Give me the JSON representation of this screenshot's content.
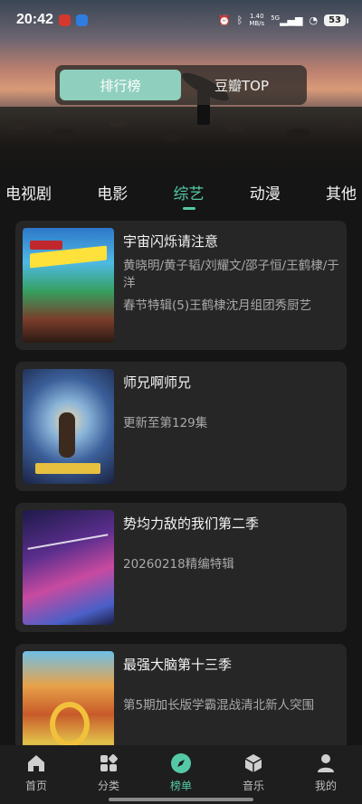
{
  "status_bar": {
    "time": "20:42",
    "net_speed_value": "1.40",
    "net_speed_unit": "MB/s",
    "network": "5G",
    "battery": "53"
  },
  "segment": {
    "tabs": [
      "排行榜",
      "豆瓣TOP"
    ],
    "active": 0
  },
  "categories": {
    "items": [
      "电视剧",
      "电影",
      "综艺",
      "动漫",
      "其他"
    ],
    "active": 2
  },
  "list": [
    {
      "title": "宇宙闪烁请注意",
      "cast": "黄晓明/黄子韬/刘耀文/邵子恒/王鹤棣/于洋",
      "subtitle": "春节特辑(5)王鹤棣沈月组团秀厨艺"
    },
    {
      "title": "师兄啊师兄",
      "subtitle": "更新至第129集"
    },
    {
      "title": "势均力敌的我们第二季",
      "subtitle": "20260218精编特辑"
    },
    {
      "title": "最强大脑第十三季",
      "subtitle": "第5期加长版学霸混战清北新人突围"
    }
  ],
  "bottom_nav": {
    "items": [
      "首页",
      "分类",
      "榜单",
      "音乐",
      "我的"
    ],
    "active": 2
  },
  "colors": {
    "accent": "#55c9a6",
    "segment_active": "#8fcfbe",
    "card_bg": "#262626",
    "page_bg": "#151515"
  }
}
